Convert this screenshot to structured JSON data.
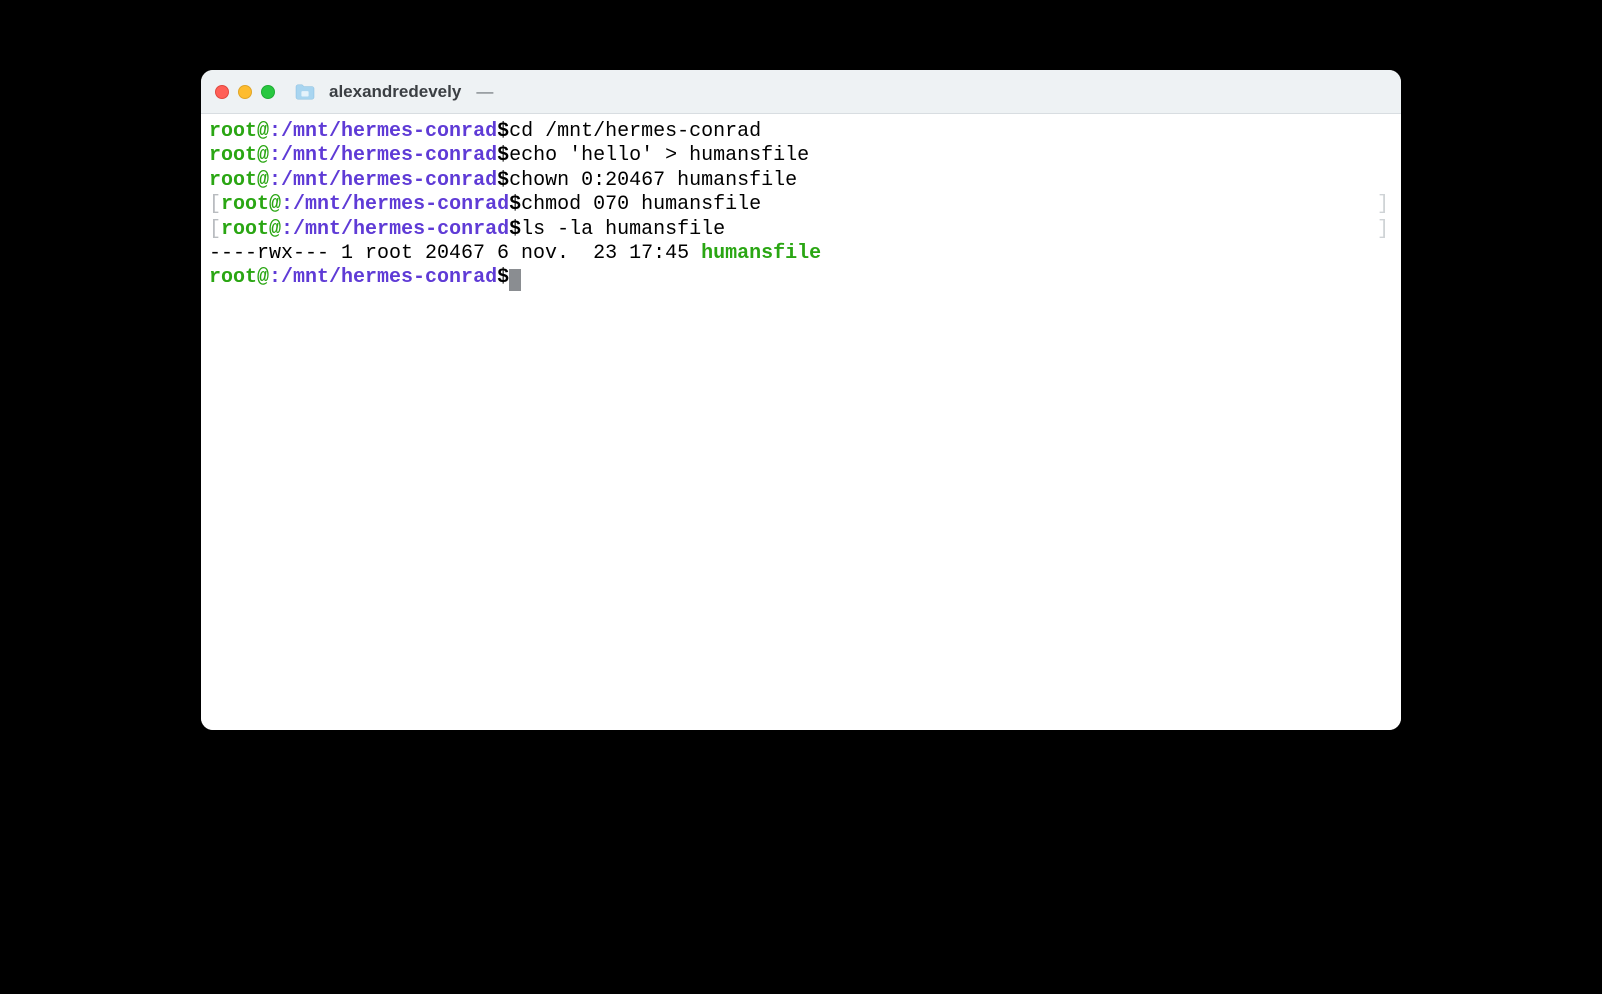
{
  "window": {
    "title": "alexandredevely",
    "title_suffix": "—"
  },
  "prompt": {
    "user_host": "root@",
    "sep": ":",
    "path": "/mnt/hermes-conrad",
    "dollar": "$"
  },
  "lines": {
    "l1_cmd": "cd /mnt/hermes-conrad",
    "l2_cmd": "echo 'hello' > humansfile",
    "l3_cmd": "chown 0:20467 humansfile",
    "l4_cmd": "chmod 070 humansfile",
    "l5_cmd": "ls -la humansfile",
    "l6_output_pre": "----rwx--- 1 root 20467 6 nov.  23 17:45 ",
    "l6_output_file": "humansfile",
    "right_bracket": "]",
    "left_bracket": "["
  }
}
